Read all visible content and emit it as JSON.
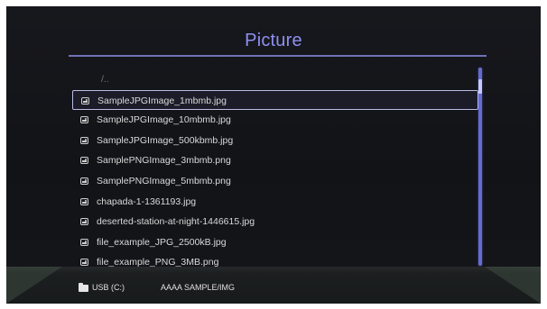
{
  "title": "Picture",
  "parent_directory_label": "/..",
  "files": [
    "SampleJPGImage_1mbmb.jpg",
    "SampleJPGImage_10mbmb.jpg",
    "SampleJPGImage_500kbmb.jpg",
    "SamplePNGImage_3mbmb.png",
    "SamplePNGImage_5mbmb.png",
    "chapada-1-1361193.jpg",
    "deserted-station-at-night-1446615.jpg",
    "file_example_JPG_2500kB.jpg",
    "file_example_PNG_3MB.png"
  ],
  "selected_index": 0,
  "status_bar": {
    "device": "USB (C:)",
    "path": "AAAA SAMPLE/IMG"
  },
  "icons": {
    "file": "image-file-icon",
    "folder": "folder-icon"
  },
  "colors": {
    "title": "#8f8ff0",
    "title_rule": "#6f72b7",
    "selection_outline": "#b8bce2",
    "scrollbar": "#666bd1",
    "text": "#d9d9d9"
  }
}
